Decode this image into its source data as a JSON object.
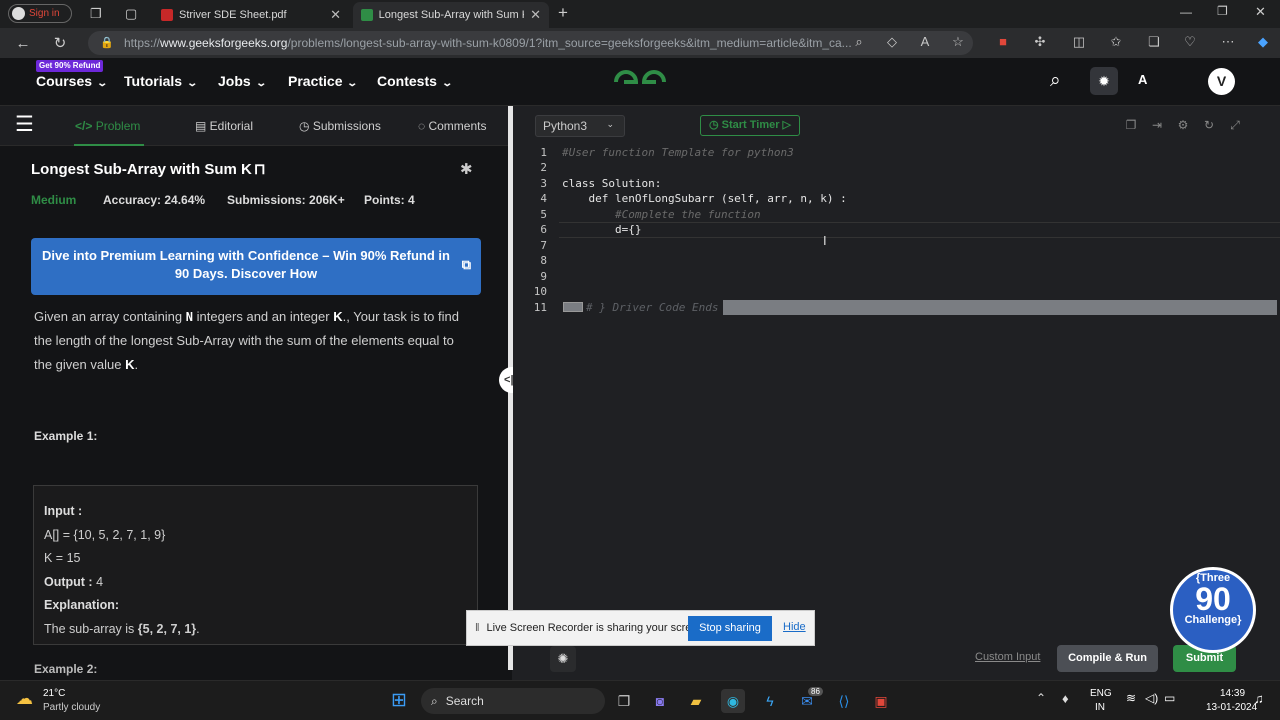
{
  "browser": {
    "profile_label": "Sign in",
    "tabs": [
      {
        "label": "Striver SDE Sheet.pdf"
      },
      {
        "label": "Longest Sub-Array with Sum K | "
      }
    ],
    "url_prefix": "https://",
    "url_domain": "www.geeksforgeeks.org",
    "url_path": "/problems/longest-sub-array-with-sum-k0809/1?itm_source=geeksforgeeks&itm_medium=article&itm_ca..."
  },
  "site": {
    "refund_badge": "Get 90% Refund",
    "nav": [
      "Courses",
      "Tutorials",
      "Jobs",
      "Practice",
      "Contests"
    ],
    "logo": "GfG",
    "avatar": "V"
  },
  "left_tabs": [
    "Problem",
    "Editorial",
    "Submissions",
    "Comments"
  ],
  "problem": {
    "title": "Longest Sub-Array with Sum K",
    "difficulty": "Medium",
    "accuracy": "Accuracy: 24.64%",
    "submissions": "Submissions: 206K+",
    "points": "Points: 4",
    "banner": "Dive into Premium Learning with Confidence – Win 90% Refund in 90 Days. Discover How",
    "desc_1": "Given an array containing ",
    "desc_n": "N",
    "desc_2": " integers and an integer ",
    "desc_k": "K",
    "desc_3": "., Your task is to find the length of the longest Sub-Array with the sum of the elements equal to the given value ",
    "desc_k2": "K",
    "desc_4": ".",
    "example1_title": "Example 1:",
    "ex_input_label": "Input :",
    "ex_input_a": "A[] = {10, 5, 2, 7, 1, 9}",
    "ex_input_k": "K = 15",
    "ex_output_label": "Output :",
    "ex_output_val": "4",
    "ex_expl_label": "Explanation:",
    "ex_expl_text": "The sub-array is ",
    "ex_expl_val": "{5, 2, 7, 1}",
    "ex_expl_end": ".",
    "example2_title": "Example 2:"
  },
  "editor": {
    "language": "Python3",
    "timer": "Start Timer",
    "line_numbers": [
      "1",
      "2",
      "3",
      "4",
      "5",
      "6",
      "7",
      "8",
      "9",
      "10",
      "11"
    ],
    "lines": [
      "#User function Template for python3",
      "",
      "class Solution:",
      "    def lenOfLongSubarr (self, arr, n, k) :",
      "        #Complete the function",
      "        d={}",
      "",
      "",
      "",
      "",
      "# } Driver Code Ends"
    ]
  },
  "actions": {
    "custom_input": "Custom Input",
    "compile": "Compile & Run",
    "submit": "Submit"
  },
  "badge": {
    "top": "{Three",
    "number": "90",
    "bottom": "Challenge}"
  },
  "recorder": {
    "message": "Live Screen Recorder is sharing your screen.",
    "stop": "Stop sharing",
    "hide": "Hide"
  },
  "taskbar": {
    "temp": "21°C",
    "weather": "Partly cloudy",
    "search": "Search",
    "lang_top": "ENG",
    "lang_bottom": "IN",
    "time": "14:39",
    "date": "13-01-2024",
    "mail_badge": "86"
  },
  "colors": {
    "accent": "#2f8d46",
    "banner": "#2f6fc4",
    "background": "#131416"
  }
}
